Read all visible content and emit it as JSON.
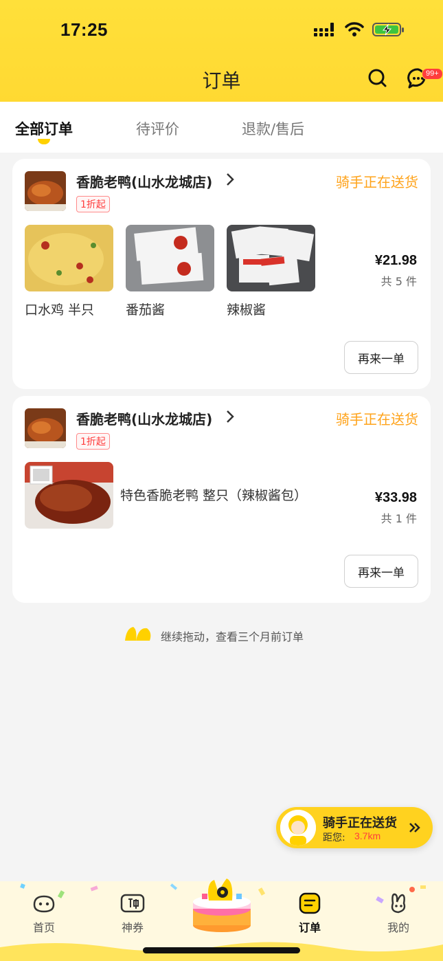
{
  "status_bar": {
    "time": "17:25"
  },
  "header": {
    "title": "订单",
    "badge": "99+"
  },
  "tabs": [
    {
      "label": "全部订单",
      "active": true
    },
    {
      "label": "待评价",
      "active": false
    },
    {
      "label": "退款/售后",
      "active": false
    }
  ],
  "orders": [
    {
      "shop_name": "香脆老鸭(山水龙城店)",
      "status": "骑手正在送货",
      "tag": "1折起",
      "items": [
        {
          "name": "口水鸡 半只"
        },
        {
          "name": "番茄酱"
        },
        {
          "name": "辣椒酱"
        }
      ],
      "price": "¥21.98",
      "count": "共 5 件",
      "reorder": "再来一单"
    },
    {
      "shop_name": "香脆老鸭(山水龙城店)",
      "status": "骑手正在送货",
      "tag": "1折起",
      "items": [
        {
          "name": "特色香脆老鸭 整只（辣椒酱包）"
        }
      ],
      "price": "¥33.98",
      "count": "共 1 件",
      "reorder": "再来一单"
    }
  ],
  "more_hint": "继续拖动，查看三个月前订单",
  "rider": {
    "title": "骑手正在送货",
    "distance_label": "距您:",
    "distance": "3.7km"
  },
  "nav": [
    {
      "label": "首页",
      "icon": "home-icon"
    },
    {
      "label": "神券",
      "icon": "coupon-icon"
    },
    {
      "label": "订单",
      "icon": "order-icon",
      "active": true
    },
    {
      "label": "我的",
      "icon": "profile-icon"
    }
  ],
  "colors": {
    "brand_yellow": "#ffd932",
    "status_orange": "#ffa31a",
    "red": "#ff3d3d"
  }
}
